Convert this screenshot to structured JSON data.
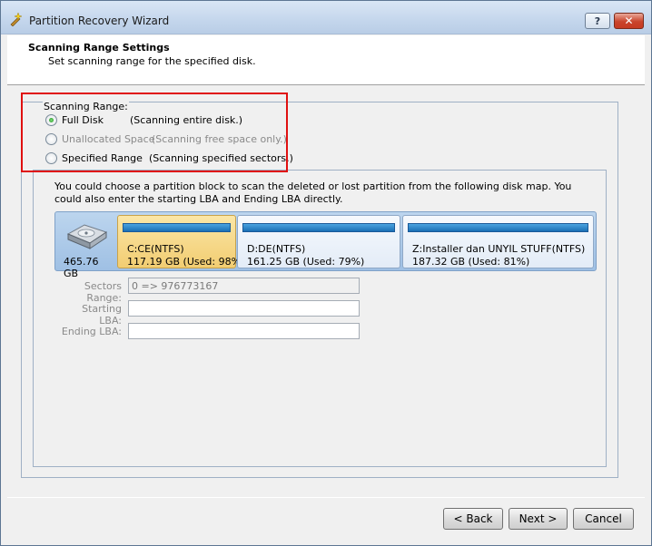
{
  "window": {
    "title": "Partition Recovery Wizard",
    "help_label": "?",
    "close_label": "✕"
  },
  "header": {
    "title": "Scanning Range Settings",
    "subtitle": "Set scanning range for the specified disk."
  },
  "scan_range": {
    "legend": "Scanning Range:",
    "selected": "full-disk",
    "options": [
      {
        "label": "Full Disk",
        "desc": "(Scanning entire disk.)",
        "checked": true,
        "enabled": true
      },
      {
        "label": "Unallocated Space",
        "desc": "(Scanning free space only.)",
        "checked": false,
        "enabled": false
      },
      {
        "label": "Specified Range",
        "desc": "(Scanning specified sectors.)",
        "checked": false,
        "enabled": true
      }
    ]
  },
  "description": "You could choose a partition block to scan the deleted or lost partition from the following disk map. You could also enter the starting LBA and Ending LBA directly.",
  "disk_map": {
    "disk_size": "465.76 GB",
    "partitions": [
      {
        "name": "C:CE(NTFS)",
        "used": "117.19 GB (Used: 98%",
        "selected": true
      },
      {
        "name": "D:DE(NTFS)",
        "used": "161.25 GB (Used: 79%)",
        "selected": false
      },
      {
        "name": "Z:Installer dan UNYIL STUFF(NTFS)",
        "used": "187.32 GB (Used: 81%)",
        "selected": false
      }
    ]
  },
  "fields": {
    "sectors_label": "Sectors Range:",
    "sectors_value": "0 => 976773167",
    "start_label": "Starting LBA:",
    "start_value": "",
    "end_label": "Ending LBA:",
    "end_value": ""
  },
  "buttons": {
    "back": "< Back",
    "next": "Next >",
    "cancel": "Cancel"
  },
  "colors": {
    "highlight": "#e01010",
    "selected_partition": "#f2cd72",
    "usage_bar": "#1a6fb5"
  }
}
